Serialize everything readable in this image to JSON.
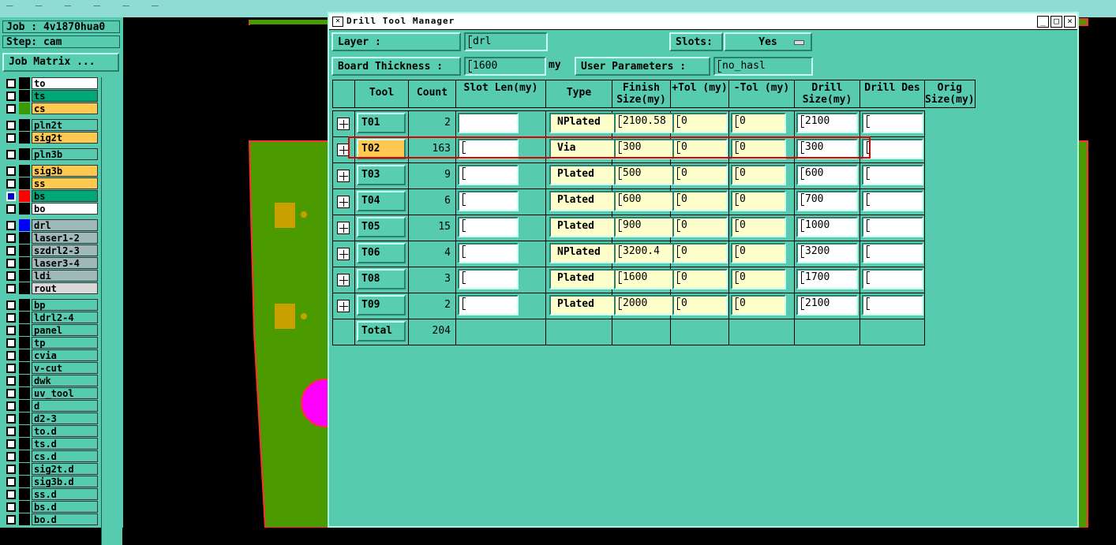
{
  "background": {
    "top_strip_marks": "_  _  _  _  _  _",
    "colors": {
      "canvas": "#000000",
      "board": "#4a9a00",
      "outline": "#ff3030",
      "pad": "#c8a000",
      "magenta_pad": "#ff00ff"
    }
  },
  "left_panel": {
    "job_label": "Job : 4v1870hua0",
    "step_label": "Step: cam",
    "job_matrix_button": "Job Matrix ...",
    "layers": [
      {
        "name": "to",
        "color": "#ffffff",
        "swatch": "#000000",
        "checked": false
      },
      {
        "name": "ts",
        "color": "#00a878",
        "swatch": "#000000",
        "checked": false
      },
      {
        "name": "cs",
        "color": "#ffc850",
        "swatch": "#3a9a00",
        "checked": false
      },
      {
        "name": "pln2t",
        "color": "#56cbb0",
        "swatch": "#000000",
        "checked": false
      },
      {
        "name": "sig2t",
        "color": "#ffc850",
        "swatch": "#000000",
        "checked": false
      },
      {
        "name": "pln3b",
        "color": "#56cbb0",
        "swatch": "#000000",
        "checked": false
      },
      {
        "name": "sig3b",
        "color": "#ffc850",
        "swatch": "#000000",
        "checked": false
      },
      {
        "name": "ss",
        "color": "#ffc850",
        "swatch": "#000000",
        "checked": false
      },
      {
        "name": "bs",
        "color": "#00a878",
        "swatch": "#ff0000",
        "checked": true
      },
      {
        "name": "bo",
        "color": "#ffffff",
        "swatch": "#000000",
        "checked": false
      },
      {
        "name": "drl",
        "color": "#9fb8b8",
        "swatch": "#0000ff",
        "checked": false
      },
      {
        "name": "laser1-2",
        "color": "#9fb8b8",
        "swatch": "#000000",
        "checked": false
      },
      {
        "name": "szdrl2-3",
        "color": "#9fb8b8",
        "swatch": "#000000",
        "checked": false
      },
      {
        "name": "laser3-4",
        "color": "#9fb8b8",
        "swatch": "#000000",
        "checked": false
      },
      {
        "name": "ldi",
        "color": "#9fb8b8",
        "swatch": "#000000",
        "checked": false
      },
      {
        "name": "rout",
        "color": "#d8d8d8",
        "swatch": "#000000",
        "checked": false
      },
      {
        "name": "bp",
        "color": "#56cbb0",
        "swatch": "#000000",
        "checked": false
      },
      {
        "name": "ldrl2-4",
        "color": "#56cbb0",
        "swatch": "#000000",
        "checked": false
      },
      {
        "name": "panel",
        "color": "#56cbb0",
        "swatch": "#000000",
        "checked": false
      },
      {
        "name": "tp",
        "color": "#56cbb0",
        "swatch": "#000000",
        "checked": false
      },
      {
        "name": "cvia",
        "color": "#56cbb0",
        "swatch": "#000000",
        "checked": false
      },
      {
        "name": "v-cut",
        "color": "#56cbb0",
        "swatch": "#000000",
        "checked": false
      },
      {
        "name": "dwk",
        "color": "#56cbb0",
        "swatch": "#000000",
        "checked": false
      },
      {
        "name": "uv_tool",
        "color": "#56cbb0",
        "swatch": "#000000",
        "checked": false
      },
      {
        "name": "d",
        "color": "#56cbb0",
        "swatch": "#000000",
        "checked": false
      },
      {
        "name": "d2-3",
        "color": "#56cbb0",
        "swatch": "#000000",
        "checked": false
      },
      {
        "name": "to.d",
        "color": "#56cbb0",
        "swatch": "#000000",
        "checked": false
      },
      {
        "name": "ts.d",
        "color": "#56cbb0",
        "swatch": "#000000",
        "checked": false
      },
      {
        "name": "cs.d",
        "color": "#56cbb0",
        "swatch": "#000000",
        "checked": false
      },
      {
        "name": "sig2t.d",
        "color": "#56cbb0",
        "swatch": "#000000",
        "checked": false
      },
      {
        "name": "sig3b.d",
        "color": "#56cbb0",
        "swatch": "#000000",
        "checked": false
      },
      {
        "name": "ss.d",
        "color": "#56cbb0",
        "swatch": "#000000",
        "checked": false
      },
      {
        "name": "bs.d",
        "color": "#56cbb0",
        "swatch": "#000000",
        "checked": false
      },
      {
        "name": "bo.d",
        "color": "#56cbb0",
        "swatch": "#000000",
        "checked": false
      }
    ]
  },
  "dialog": {
    "title": "Drill Tool Manager",
    "window_buttons": {
      "minimize": "_",
      "maximize": "□",
      "close": "×"
    },
    "layer_label": "Layer       :",
    "layer_value": "drl",
    "slots_label": "Slots:",
    "slots_value": "Yes",
    "board_thickness_label": "Board Thickness :",
    "board_thickness_value": "1600",
    "board_thickness_unit": "my",
    "user_params_label": "User Parameters :",
    "user_params_value": "no_hasl",
    "columns": [
      "Tool",
      "Count",
      "Slot Len(my)",
      "Type",
      "Finish Size(my)",
      "+Tol (my)",
      "-Tol (my)",
      "Drill Size(my)",
      "Drill Des",
      "Orig Size(my)"
    ],
    "rows": [
      {
        "tool": "T01",
        "count": "2",
        "slot_len": "",
        "type": "NPlated",
        "finish": "2100.58",
        "ptol": "0",
        "mtol": "0",
        "drill": "2100",
        "des": "",
        "highlight": false
      },
      {
        "tool": "T02",
        "count": "163",
        "slot_len": "",
        "type": "Via",
        "finish": "300",
        "ptol": "0",
        "mtol": "0",
        "drill": "300",
        "des": "",
        "highlight": true
      },
      {
        "tool": "T03",
        "count": "9",
        "slot_len": "",
        "type": "Plated",
        "finish": "500",
        "ptol": "0",
        "mtol": "0",
        "drill": "600",
        "des": "",
        "highlight": false
      },
      {
        "tool": "T04",
        "count": "6",
        "slot_len": "",
        "type": "Plated",
        "finish": "600",
        "ptol": "0",
        "mtol": "0",
        "drill": "700",
        "des": "",
        "highlight": false
      },
      {
        "tool": "T05",
        "count": "15",
        "slot_len": "",
        "type": "Plated",
        "finish": "900",
        "ptol": "0",
        "mtol": "0",
        "drill": "1000",
        "des": "",
        "highlight": false
      },
      {
        "tool": "T06",
        "count": "4",
        "slot_len": "",
        "type": "NPlated",
        "finish": "3200.4",
        "ptol": "0",
        "mtol": "0",
        "drill": "3200",
        "des": "",
        "highlight": false
      },
      {
        "tool": "T08",
        "count": "3",
        "slot_len": "",
        "type": "Plated",
        "finish": "1600",
        "ptol": "0",
        "mtol": "0",
        "drill": "1700",
        "des": "",
        "highlight": false
      },
      {
        "tool": "T09",
        "count": "2",
        "slot_len": "",
        "type": "Plated",
        "finish": "2000",
        "ptol": "0",
        "mtol": "0",
        "drill": "2100",
        "des": "",
        "highlight": false
      }
    ],
    "total_label": "Total",
    "total_count": "204"
  }
}
